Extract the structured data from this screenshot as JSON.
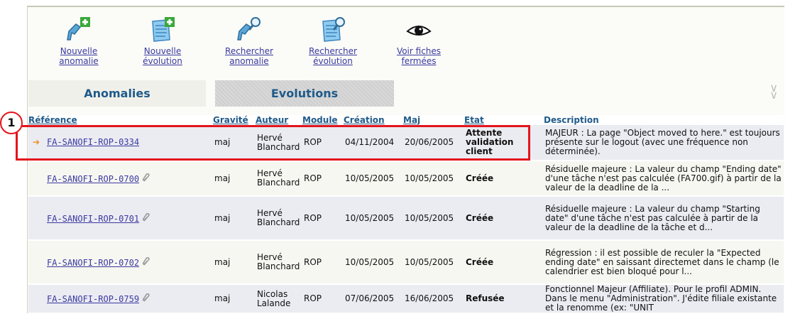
{
  "toolbar": {
    "items": [
      {
        "label": "Nouvelle\nanomalie",
        "icon": "add-anomaly-icon"
      },
      {
        "label": "Nouvelle\névolution",
        "icon": "add-evolution-icon"
      },
      {
        "label": "Rechercher\nanomalie",
        "icon": "search-anomaly-icon"
      },
      {
        "label": "Rechercher\névolution",
        "icon": "search-evolution-icon"
      },
      {
        "label": "Voir fiches\nfermées",
        "icon": "eye-icon"
      }
    ]
  },
  "tabs": {
    "anomalies": "Anomalies",
    "evolutions": "Evolutions"
  },
  "columns": {
    "reference": "Référence",
    "gravite": "Gravité",
    "auteur": "Auteur",
    "module": "Module",
    "creation": "Création",
    "maj": "Maj",
    "etat": "Etat",
    "description": "Description"
  },
  "rows": [
    {
      "ref": "FA-SANOFI-ROP-0334",
      "gravite": "maj",
      "auteur": "Hervé\nBlanchard",
      "module": "ROP",
      "creation": "04/11/2004",
      "maj": "20/06/2005",
      "etat": "Attente\nvalidation\nclient",
      "desc": "MAJEUR : La page \"Object moved to here.\" est toujours présente sur le logout (avec une fréquence non déterminée)."
    },
    {
      "ref": "FA-SANOFI-ROP-0700",
      "gravite": "maj",
      "auteur": "Hervé\nBlanchard",
      "module": "ROP",
      "creation": "10/05/2005",
      "maj": "10/05/2005",
      "etat": "Créée",
      "desc": "Résiduelle majeure : La valeur du champ \"Ending date\" d'une tâche n'est pas calculée (FA700.gif) à partir de la valeur de la deadline de la ..."
    },
    {
      "ref": "FA-SANOFI-ROP-0701",
      "gravite": "maj",
      "auteur": "Hervé\nBlanchard",
      "module": "ROP",
      "creation": "10/05/2005",
      "maj": "10/05/2005",
      "etat": "Créée",
      "desc": "Résiduelle majeure : La valeur du champ \"Starting date\" d'une tâche n'est pas calculée à partir de la valeur de la deadline de la tâche et d..."
    },
    {
      "ref": "FA-SANOFI-ROP-0702",
      "gravite": "maj",
      "auteur": "Hervé\nBlanchard",
      "module": "ROP",
      "creation": "10/05/2005",
      "maj": "10/05/2005",
      "etat": "Créée",
      "desc": "Régression : il est possible de reculer la \"Expected ending date\" en saissant directemet dans le champ (le calendrier est bien bloqué pour l..."
    },
    {
      "ref": "FA-SANOFI-ROP-0759",
      "gravite": "maj",
      "auteur": "Nicolas\nLalande",
      "module": "ROP",
      "creation": "07/06/2005",
      "maj": "16/06/2005",
      "etat": "Refusée",
      "desc": "Fonctionnel Majeur (Affiliate). Pour le profil ADMIN. Dans le menu \"Administration\". J'édite filiale existante et la renomme (ex: \"UNIT"
    }
  ],
  "callout": {
    "number": "1"
  },
  "colors": {
    "link": "#3a3aa0",
    "state": "#e0188a",
    "header": "#1f5a8a",
    "highlight": "#e3141c"
  }
}
